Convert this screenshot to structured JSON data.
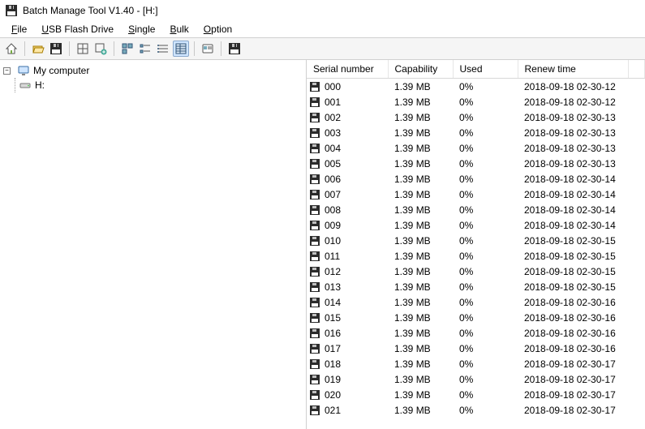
{
  "titlebar": {
    "title": "Batch Manage Tool V1.40  - [H:]"
  },
  "menu": {
    "file": "File",
    "usb": "USB Flash Drive",
    "single": "Single",
    "bulk": "Bulk",
    "option": "Option"
  },
  "tree": {
    "root": "My computer",
    "drive": "H:"
  },
  "columns": {
    "sn": "Serial number",
    "cap": "Capability",
    "used": "Used",
    "renew": "Renew time"
  },
  "rows": [
    {
      "sn": "000",
      "cap": "1.39 MB",
      "used": "0%",
      "renew": "2018-09-18 02-30-12"
    },
    {
      "sn": "001",
      "cap": "1.39 MB",
      "used": "0%",
      "renew": "2018-09-18 02-30-12"
    },
    {
      "sn": "002",
      "cap": "1.39 MB",
      "used": "0%",
      "renew": "2018-09-18 02-30-13"
    },
    {
      "sn": "003",
      "cap": "1.39 MB",
      "used": "0%",
      "renew": "2018-09-18 02-30-13"
    },
    {
      "sn": "004",
      "cap": "1.39 MB",
      "used": "0%",
      "renew": "2018-09-18 02-30-13"
    },
    {
      "sn": "005",
      "cap": "1.39 MB",
      "used": "0%",
      "renew": "2018-09-18 02-30-13"
    },
    {
      "sn": "006",
      "cap": "1.39 MB",
      "used": "0%",
      "renew": "2018-09-18 02-30-14"
    },
    {
      "sn": "007",
      "cap": "1.39 MB",
      "used": "0%",
      "renew": "2018-09-18 02-30-14"
    },
    {
      "sn": "008",
      "cap": "1.39 MB",
      "used": "0%",
      "renew": "2018-09-18 02-30-14"
    },
    {
      "sn": "009",
      "cap": "1.39 MB",
      "used": "0%",
      "renew": "2018-09-18 02-30-14"
    },
    {
      "sn": "010",
      "cap": "1.39 MB",
      "used": "0%",
      "renew": "2018-09-18 02-30-15"
    },
    {
      "sn": "011",
      "cap": "1.39 MB",
      "used": "0%",
      "renew": "2018-09-18 02-30-15"
    },
    {
      "sn": "012",
      "cap": "1.39 MB",
      "used": "0%",
      "renew": "2018-09-18 02-30-15"
    },
    {
      "sn": "013",
      "cap": "1.39 MB",
      "used": "0%",
      "renew": "2018-09-18 02-30-15"
    },
    {
      "sn": "014",
      "cap": "1.39 MB",
      "used": "0%",
      "renew": "2018-09-18 02-30-16"
    },
    {
      "sn": "015",
      "cap": "1.39 MB",
      "used": "0%",
      "renew": "2018-09-18 02-30-16"
    },
    {
      "sn": "016",
      "cap": "1.39 MB",
      "used": "0%",
      "renew": "2018-09-18 02-30-16"
    },
    {
      "sn": "017",
      "cap": "1.39 MB",
      "used": "0%",
      "renew": "2018-09-18 02-30-16"
    },
    {
      "sn": "018",
      "cap": "1.39 MB",
      "used": "0%",
      "renew": "2018-09-18 02-30-17"
    },
    {
      "sn": "019",
      "cap": "1.39 MB",
      "used": "0%",
      "renew": "2018-09-18 02-30-17"
    },
    {
      "sn": "020",
      "cap": "1.39 MB",
      "used": "0%",
      "renew": "2018-09-18 02-30-17"
    },
    {
      "sn": "021",
      "cap": "1.39 MB",
      "used": "0%",
      "renew": "2018-09-18 02-30-17"
    }
  ]
}
